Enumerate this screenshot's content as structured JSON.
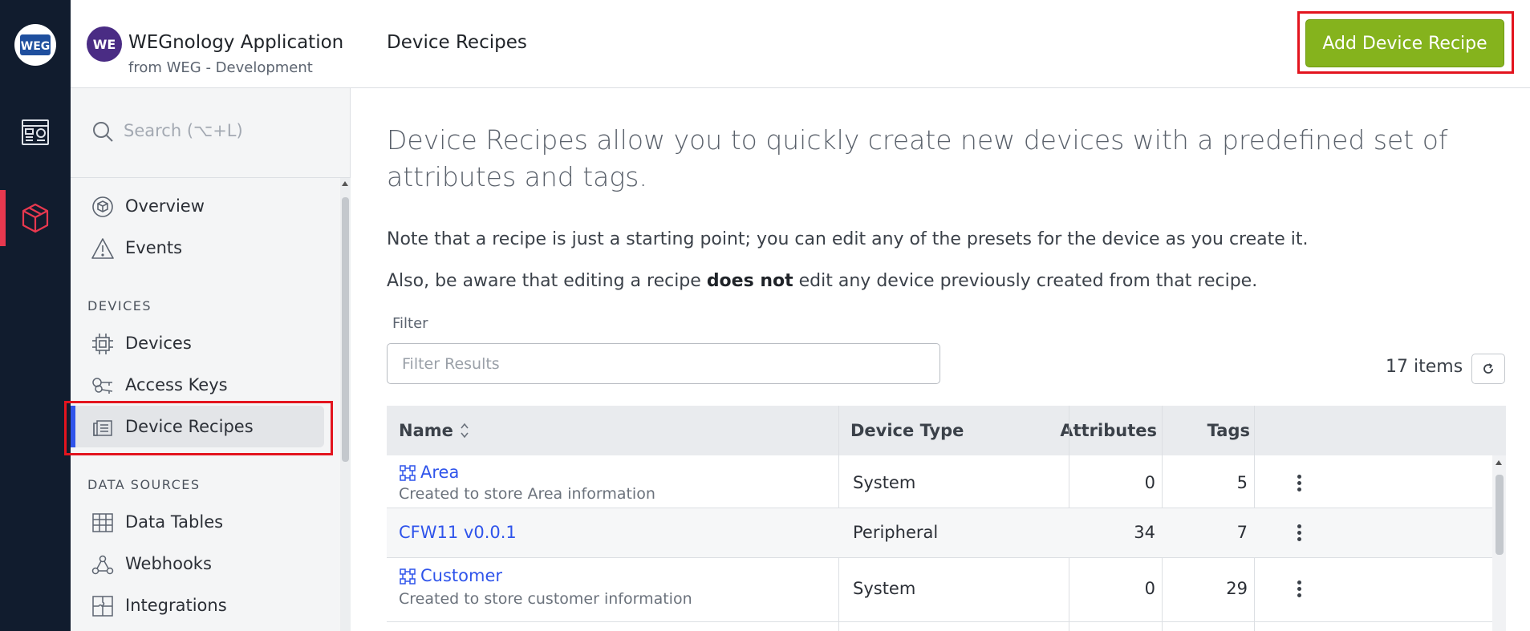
{
  "rail": {
    "logo_text": "WEG",
    "items": [
      {
        "icon": "dashboard-icon"
      },
      {
        "icon": "cube-icon",
        "active": true
      }
    ]
  },
  "sidebar": {
    "app_avatar": "WE",
    "app_name": "WEGnology Application",
    "app_sub": "from WEG - Development",
    "search_placeholder": "Search (⌥+L)",
    "items": [
      {
        "label": "Overview",
        "icon": "overview-icon"
      },
      {
        "label": "Events",
        "icon": "warning-icon"
      }
    ],
    "section_devices": "DEVICES",
    "devices_items": [
      {
        "label": "Devices",
        "icon": "chip-icon"
      },
      {
        "label": "Access Keys",
        "icon": "keys-icon"
      },
      {
        "label": "Device Recipes",
        "icon": "recipe-icon",
        "active": true
      }
    ],
    "section_data": "DATA SOURCES",
    "data_items": [
      {
        "label": "Data Tables",
        "icon": "table-icon"
      },
      {
        "label": "Webhooks",
        "icon": "webhook-icon"
      },
      {
        "label": "Integrations",
        "icon": "puzzle-icon"
      }
    ]
  },
  "main": {
    "title": "Device Recipes",
    "add_button": "Add Device Recipe",
    "intro": "Device Recipes allow you to quickly create new devices with a predefined set of attributes and tags.",
    "note1": "Note that a recipe is just a starting point; you can edit any of the presets for the device as you create it.",
    "note2_pre": "Also, be aware that editing a recipe ",
    "note2_bold": "does not",
    "note2_post": " edit any device previously created from that recipe.",
    "filter_label": "Filter",
    "filter_placeholder": "Filter Results",
    "item_count": "17 items",
    "table": {
      "headers": [
        "Name",
        "Device Type",
        "Attributes",
        "Tags"
      ],
      "rows": [
        {
          "name": "Area",
          "desc": "Created to store Area information",
          "type": "System",
          "attributes": "0",
          "tags": "5",
          "system": true
        },
        {
          "name": "CFW11 v0.0.1",
          "desc": "",
          "type": "Peripheral",
          "attributes": "34",
          "tags": "7",
          "system": false
        },
        {
          "name": "Customer",
          "desc": "Created to store customer information",
          "type": "System",
          "attributes": "0",
          "tags": "29",
          "system": true
        }
      ]
    }
  },
  "colors": {
    "rail_bg": "#111c2e",
    "accent_red": "#e8384f",
    "primary_green": "#85b31d",
    "link_blue": "#2f54eb",
    "highlight_red": "#e3141e"
  }
}
